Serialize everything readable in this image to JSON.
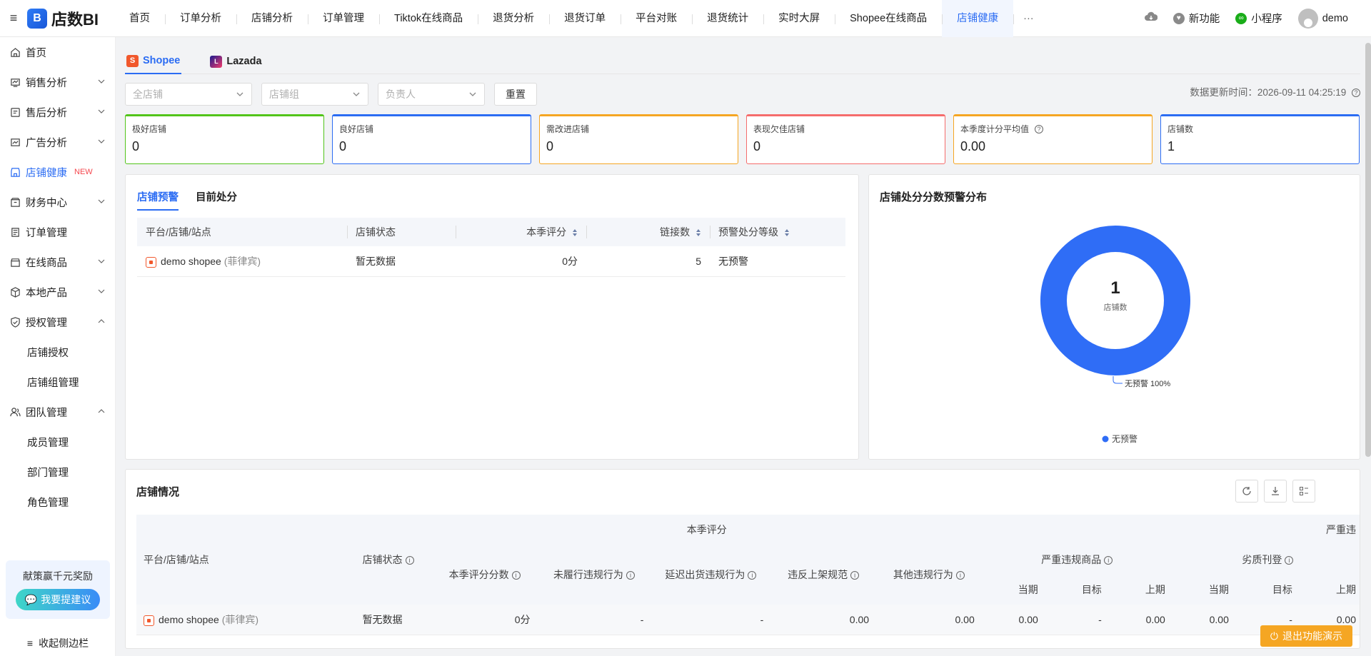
{
  "app": {
    "logo_text": "店数BI"
  },
  "nav_tabs": [
    "首页",
    "订单分析",
    "店铺分析",
    "订单管理",
    "Tiktok在线商品",
    "退货分析",
    "退货订单",
    "平台对账",
    "退货统计",
    "实时大屏",
    "Shopee在线商品",
    "店铺健康"
  ],
  "nav_more": "···",
  "topright": {
    "new_feature": "新功能",
    "mini_program": "小程序",
    "user": "demo"
  },
  "sidebar": {
    "items": [
      {
        "label": "首页",
        "icon": "home-icon"
      },
      {
        "label": "销售分析",
        "icon": "sales-icon"
      },
      {
        "label": "售后分析",
        "icon": "aftersale-icon"
      },
      {
        "label": "广告分析",
        "icon": "ad-icon"
      },
      {
        "label": "店铺健康",
        "icon": "shop-icon",
        "badge": "NEW"
      },
      {
        "label": "财务中心",
        "icon": "finance-icon"
      },
      {
        "label": "订单管理",
        "icon": "order-icon"
      },
      {
        "label": "在线商品",
        "icon": "goods-icon"
      },
      {
        "label": "本地产品",
        "icon": "product-icon"
      },
      {
        "label": "授权管理",
        "icon": "auth-icon"
      },
      {
        "label": "团队管理",
        "icon": "team-icon"
      }
    ],
    "auth_sub": [
      "店铺授权",
      "店铺组管理"
    ],
    "team_sub": [
      "成员管理",
      "部门管理",
      "角色管理"
    ],
    "promo_title": "献策赢千元奖励",
    "promo_button": "我要提建议",
    "collapse": "收起侧边栏"
  },
  "platform_tabs": [
    "Shopee",
    "Lazada"
  ],
  "filters": {
    "shop": "全店铺",
    "group": "店铺组",
    "owner": "负责人",
    "reset": "重置"
  },
  "update_time": "数据更新时间：2026-09-11 04:25:19",
  "kpis": [
    {
      "label": "极好店铺",
      "value": "0",
      "color": "#52c41a"
    },
    {
      "label": "良好店铺",
      "value": "0",
      "color": "#2b6cf3"
    },
    {
      "label": "需改进店铺",
      "value": "0",
      "color": "#f5a623"
    },
    {
      "label": "表现欠佳店铺",
      "value": "0",
      "color": "#f56c6c"
    },
    {
      "label": "本季度计分平均值",
      "value": "0.00",
      "color": "#f5a623"
    },
    {
      "label": "店铺数",
      "value": "1",
      "color": "#2b6cf3"
    }
  ],
  "warning_card": {
    "tabs": [
      "店铺预警",
      "目前处分"
    ],
    "columns": [
      "平台/店铺/站点",
      "店铺状态",
      "本季评分",
      "链接数",
      "预警处分等级"
    ],
    "rows": [
      {
        "shop": "demo shopee",
        "region": "(菲律宾)",
        "status": "暂无数据",
        "score": "0分",
        "links": "5",
        "level": "无预警"
      }
    ]
  },
  "chart_card": {
    "title": "店铺处分分数预警分布"
  },
  "chart_data": {
    "type": "pie",
    "center_value": "1",
    "center_label": "店铺数",
    "slices": [
      {
        "name": "无预警",
        "value": 1,
        "percent": 100,
        "color": "#2f6df6"
      }
    ],
    "slice_label": "无预警 100%",
    "legend": [
      "无预警"
    ],
    "legend_position": "bottom"
  },
  "situation_card": {
    "title": "店铺情况",
    "group_headers": {
      "season": "本季评分",
      "serious": "严重违"
    },
    "columns_main": [
      "平台/店铺/站点",
      "店铺状态"
    ],
    "season_cols": [
      "本季评分分数",
      "未履行违规行为",
      "延迟出货违规行为",
      "违反上架规范",
      "其他违规行为"
    ],
    "sub_groups": [
      "严重违规商品",
      "劣质刊登"
    ],
    "period_cols": [
      "当期",
      "目标",
      "上期",
      "当期",
      "目标",
      "上期"
    ],
    "rows": [
      {
        "shop": "demo shopee",
        "region": "(菲律宾)",
        "status": "暂无数据",
        "cells": [
          "0分",
          "-",
          "-",
          "0.00",
          "0.00",
          "0.00",
          "-",
          "0.00",
          "0.00",
          "-",
          "0.00"
        ]
      }
    ]
  },
  "exit_demo": "退出功能演示"
}
